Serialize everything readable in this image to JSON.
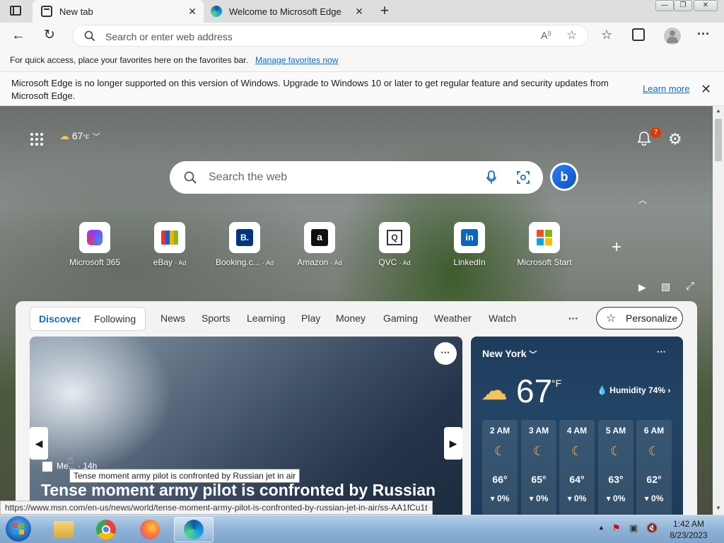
{
  "tabs": [
    {
      "label": "New tab",
      "active": true
    },
    {
      "label": "Welcome to Microsoft Edge",
      "active": false
    }
  ],
  "address": {
    "placeholder": "Search or enter web address"
  },
  "favorites_bar": {
    "text": "For quick access, place your favorites here on the favorites bar.",
    "link": "Manage favorites now"
  },
  "infobar": {
    "message": "Microsoft Edge is no longer supported on this version of Windows. Upgrade to Windows 10 or later to get regular feature and security updates from Microsoft Edge.",
    "link": "Learn more"
  },
  "ntp": {
    "weather_temp": "67",
    "weather_unit": "°F",
    "notification_count": "7",
    "search_placeholder": "Search the web",
    "tiles": [
      {
        "label": "Microsoft 365",
        "ad": ""
      },
      {
        "label": "eBay",
        "ad": "· Ad"
      },
      {
        "label": "Booking.c...",
        "ad": "· Ad"
      },
      {
        "label": "Amazon",
        "ad": "· Ad"
      },
      {
        "label": "QVC",
        "ad": "· Ad"
      },
      {
        "label": "LinkedIn",
        "ad": ""
      },
      {
        "label": "Microsoft Start",
        "ad": ""
      }
    ]
  },
  "feed": {
    "segments": [
      "Discover",
      "Following"
    ],
    "nav": [
      "News",
      "Sports",
      "Learning",
      "Play",
      "Money",
      "Gaming",
      "Weather",
      "Watch"
    ],
    "more": "···",
    "personalize": "Personalize",
    "story": {
      "source": "Me... · 14h",
      "headline": "Tense moment army pilot is confronted by Russian",
      "tooltip": "Tense moment army pilot is confronted by Russian jet in air"
    },
    "weather": {
      "city": "New York",
      "temp": "67",
      "unit": "°F",
      "humidity": "Humidity 74%",
      "hours": [
        {
          "time": "2 AM",
          "temp": "66°",
          "precip": "0%"
        },
        {
          "time": "3 AM",
          "temp": "65°",
          "precip": "0%"
        },
        {
          "time": "4 AM",
          "temp": "64°",
          "precip": "0%"
        },
        {
          "time": "5 AM",
          "temp": "63°",
          "precip": "0%"
        },
        {
          "time": "6 AM",
          "temp": "62°",
          "precip": "0%"
        }
      ]
    }
  },
  "status_url": "https://www.msn.com/en-us/news/world/tense-moment-army-pilot-is-confronted-by-russian-jet-in-air/ss-AA1fCu1t",
  "taskbar": {
    "time": "1:42 AM",
    "date": "8/23/2023"
  }
}
